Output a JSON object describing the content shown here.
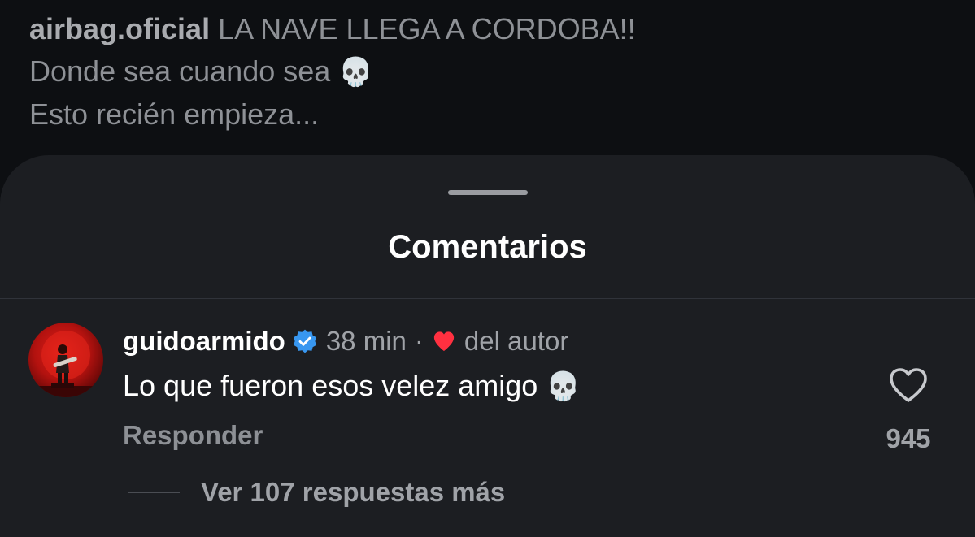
{
  "post": {
    "username": "airbag.oficial",
    "caption_line1": "LA NAVE LLEGA A CORDOBA!!",
    "caption_line2": "Donde sea cuando sea",
    "caption_line3": "Esto recién empieza...",
    "caption_dot": ".",
    "emoji": "💀"
  },
  "sheet": {
    "title": "Comentarios"
  },
  "comment": {
    "author": "guidoarmido",
    "verified": true,
    "time": "38 min",
    "separator": "·",
    "liked_by_author_label": "del autor",
    "text": "Lo que fueron esos velez amigo",
    "emoji": "💀",
    "reply_label": "Responder",
    "like_count": "945",
    "view_replies_label": "Ver 107 respuestas más"
  },
  "colors": {
    "background": "#0d0f12",
    "sheet": "#1c1e22",
    "verified_blue": "#3897f0",
    "heart_red": "#ff3040",
    "muted_text": "#a0a3a8"
  }
}
